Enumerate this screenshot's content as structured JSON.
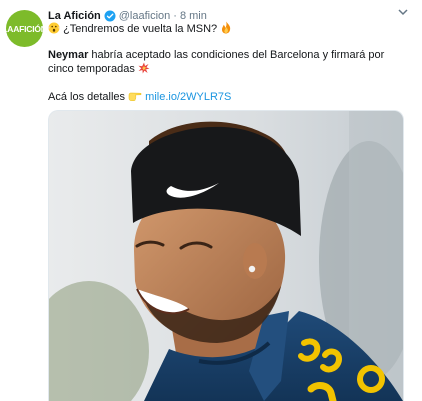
{
  "account": {
    "avatar_text": "LAAFICIÓN",
    "name": "La Afición",
    "handle": "@laaficion",
    "separator": "·",
    "time": "8 min"
  },
  "tweet": {
    "line1": "¿Tendremos de vuelta la MSN?",
    "line2_bold": "Neymar",
    "line2_text": " habría aceptado las condiciones del Barcelona y firmará por cinco temporadas",
    "line3_text": "Acá los detalles",
    "link": "mile.io/2WYLR7S"
  },
  "media": {
    "description": "photo",
    "shirt_text": "BC"
  },
  "colors": {
    "brand": "#7dbb2a",
    "link": "#1b95e0",
    "secondary_text": "#657786"
  },
  "icons": [
    "verified-icon",
    "surprised-emoji-icon",
    "fire-emoji-icon",
    "explosion-emoji-icon",
    "pointing-hand-emoji-icon",
    "chevron-down-icon"
  ]
}
